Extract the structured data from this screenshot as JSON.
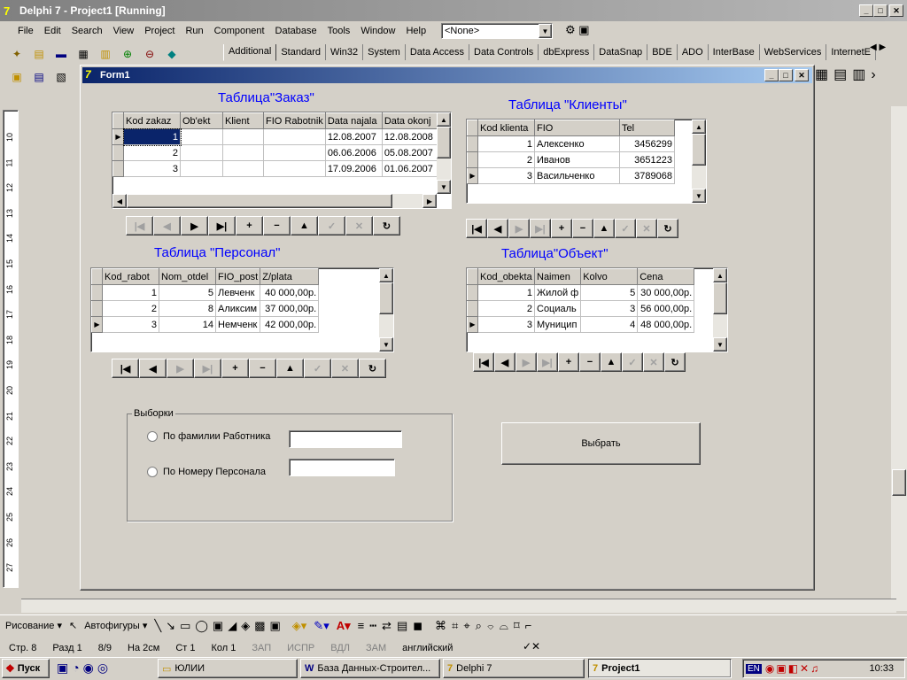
{
  "delphi": {
    "title": "Delphi 7 - Project1 [Running]",
    "menu": [
      "File",
      "Edit",
      "Search",
      "View",
      "Project",
      "Run",
      "Component",
      "Database",
      "Tools",
      "Window",
      "Help"
    ],
    "combo": "<None>",
    "tabs": [
      "Additional",
      "Standard",
      "Win32",
      "System",
      "Data Access",
      "Data Controls",
      "dbExpress",
      "DataSnap",
      "BDE",
      "ADO",
      "InterBase",
      "WebServices",
      "InternetE"
    ],
    "active_tab": "Additional"
  },
  "form": {
    "title": "Form1",
    "orders": {
      "caption": "Таблица\"Заказ\"",
      "columns": [
        "Kod zakaz",
        "Ob'ekt",
        "Klient",
        "FIO Rabotnik",
        "Data najala",
        "Data okonj"
      ],
      "rows": [
        [
          "1",
          "",
          "",
          "",
          "12.08.2007",
          "12.08.2008"
        ],
        [
          "2",
          "",
          "",
          "",
          "06.06.2006",
          "05.08.2007"
        ],
        [
          "3",
          "",
          "",
          "",
          "17.09.2006",
          "01.06.2007"
        ]
      ]
    },
    "clients": {
      "caption": "Таблица \"Клиенты\"",
      "columns": [
        "Kod klienta",
        "FIO",
        "Tel"
      ],
      "rows": [
        [
          "1",
          "Алексенко",
          "3456299"
        ],
        [
          "2",
          "Иванов",
          "3651223"
        ],
        [
          "3",
          "Васильченко",
          "3789068"
        ]
      ]
    },
    "personal": {
      "caption": "Таблица \"Персонал\"",
      "columns": [
        "Kod_rabot",
        "Nom_otdel",
        "FIO_post",
        "Z/plata"
      ],
      "rows": [
        [
          "1",
          "5",
          "Левченк",
          "40 000,00р."
        ],
        [
          "2",
          "8",
          "Аликсим",
          "37 000,00р."
        ],
        [
          "3",
          "14",
          "Немченк",
          "42 000,00р."
        ]
      ]
    },
    "objects": {
      "caption": "Таблица\"Объект\"",
      "columns": [
        "Kod_obekta",
        "Naimen",
        "Kolvo",
        "Cena"
      ],
      "rows": [
        [
          "1",
          "Жилой ф",
          "5",
          "30 000,00р."
        ],
        [
          "2",
          "Социаль",
          "3",
          "56 000,00р."
        ],
        [
          "3",
          "Муницип",
          "4",
          "48 000,00р."
        ]
      ]
    },
    "group": {
      "label": "Выборки",
      "opt1": "По фамилии Работника",
      "opt2": "По Номеру Персонала"
    },
    "select_button": "Выбрать"
  },
  "word": {
    "draw": "Рисование ▾",
    "autoshapes": "Автофигуры ▾",
    "status": [
      "Стр. 8",
      "Разд 1",
      "8/9",
      "На 2см",
      "Ст 1",
      "Кол 1",
      "ЗАП",
      "ИСПР",
      "ВДЛ",
      "ЗАМ",
      "английский"
    ]
  },
  "ruler": [
    "10",
    "11",
    "12",
    "13",
    "14",
    "15",
    "16",
    "17",
    "18",
    "19",
    "20",
    "21",
    "22",
    "23",
    "24",
    "25",
    "26",
    "27"
  ],
  "taskbar": {
    "start": "Пуск",
    "items": [
      "ЮЛИИ",
      "База Данных-Строител...",
      "Delphi 7",
      "Project1"
    ],
    "lang": "EN",
    "clock": "10:33"
  }
}
